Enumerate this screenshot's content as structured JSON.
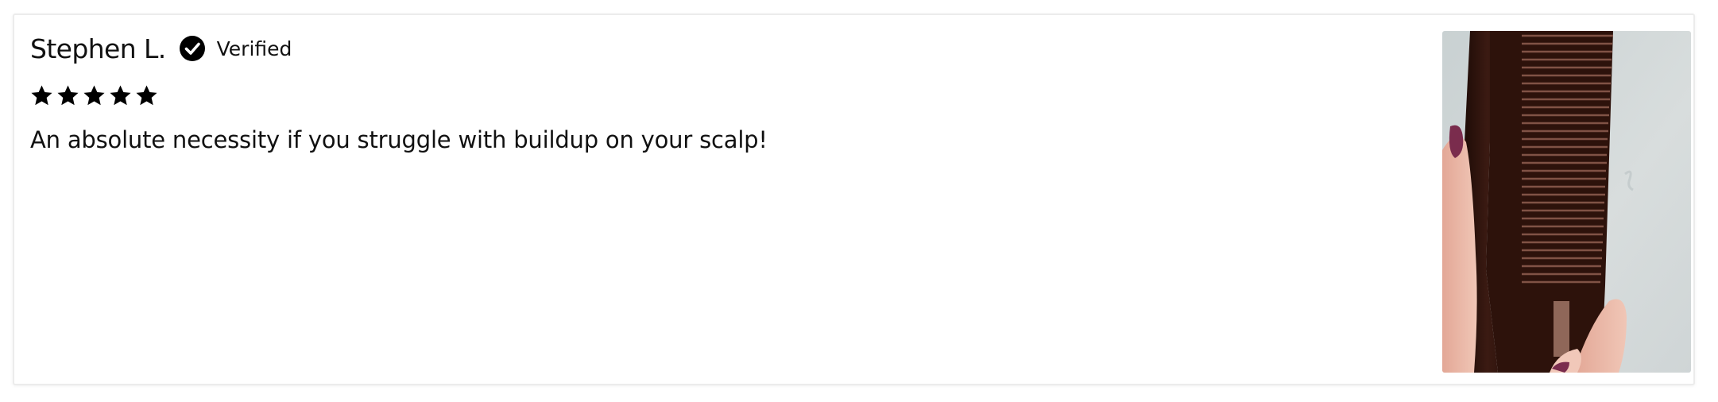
{
  "review": {
    "reviewer_name": "Stephen L.",
    "verified_label": "Verified",
    "verified_icon": "check-circle-icon",
    "rating": 5,
    "rating_max": 5,
    "star_icon": "star-icon",
    "body": "An absolute necessity if you struggle with buildup on your scalp!",
    "photo_icon": "review-photo-comb"
  },
  "colors": {
    "text": "#111111",
    "card_border": "#ececec",
    "star": "#000000",
    "badge": "#000000"
  }
}
